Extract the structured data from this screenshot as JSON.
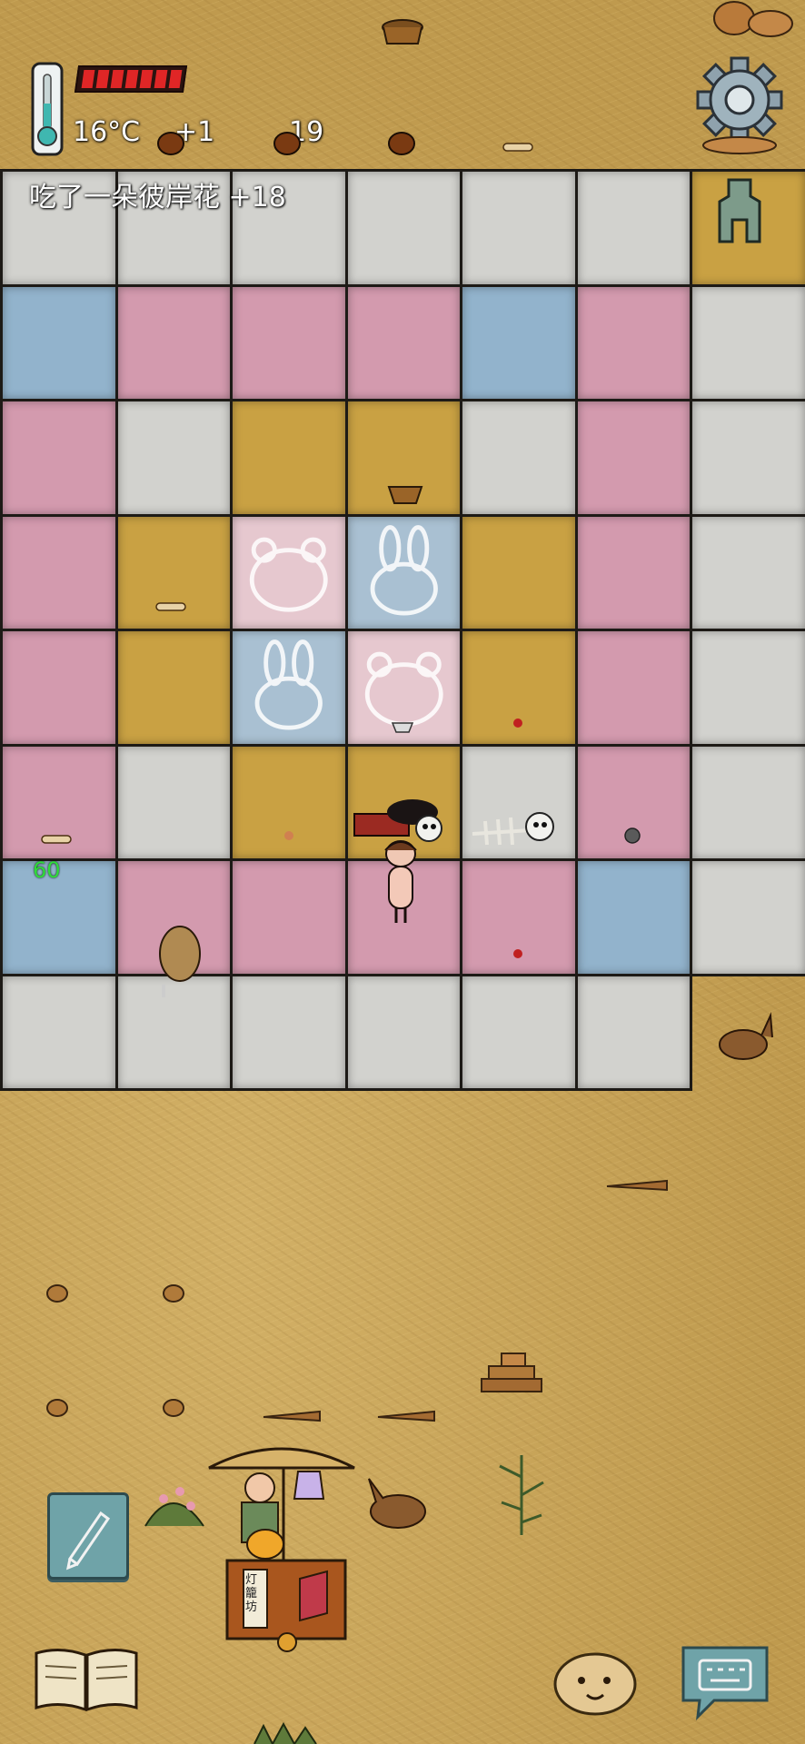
{
  "hud": {
    "temperature": "16°C",
    "temp_delta": "+1",
    "count": "19",
    "message": "吃了一朵彼岸花 +18",
    "health_segments": 7,
    "health_fraction": 1.0
  },
  "player": {
    "hp_label": "60"
  },
  "vendor": {
    "sign_text": "灯籠坊"
  },
  "colors": {
    "white_tile": "#d2d2ce",
    "pink_tile": "#d39aae",
    "blue_tile": "#92b3cc",
    "yellow_tile": "#c9a143",
    "health_red": "#e02626",
    "hp_green": "#2fdc3a"
  },
  "grid": {
    "rows": [
      "wwwwwwy",
      "bpppbpw",
      "pwyywpw",
      "pyLRypw",
      "pyRLypw",
      "pwyywpw",
      "bppppbw",
      "wwwwww."
    ],
    "legend": {
      "w": "white",
      "p": "pink",
      "b": "blue",
      "y": "yellow",
      "L": "light-pink-bear-motif",
      "R": "light-blue-rabbit-motif"
    }
  },
  "icons": {
    "thermometer": "thermometer-icon",
    "settings": "gear-icon",
    "totem": "totem-icon",
    "note": "pencil-note-icon",
    "journal": "open-book-icon",
    "emote": "face-icon",
    "chat": "keyboard-bubble-icon"
  }
}
